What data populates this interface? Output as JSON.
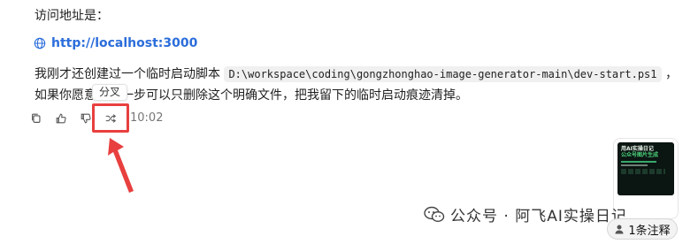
{
  "message": {
    "access_label": "访问地址是：",
    "url": "http://localhost:3000",
    "para_before": "我刚才还创建过一个临时启动脚本 ",
    "code": "D:\\workspace\\coding\\gongzhonghao-image-generator-main\\dev-start.ps1",
    "para_after": " ，如果你愿意，下一步可以只删除这个明确文件，把我留下的临时启动痕迹清掉。"
  },
  "tooltip": {
    "label": "分叉"
  },
  "actions": {
    "icons": [
      "copy-icon",
      "thumbs-up-icon",
      "thumbs-down-icon",
      "fork-icon"
    ],
    "time": "10:02"
  },
  "highlight_color": "#e8403f",
  "thumbnail": {
    "line1": "用AI实操日记",
    "line2": "公众号图片生成"
  },
  "watermark": {
    "text": "公众号 · 阿飞AI实操日记"
  },
  "annotation_pill": {
    "label": "1条注释"
  }
}
